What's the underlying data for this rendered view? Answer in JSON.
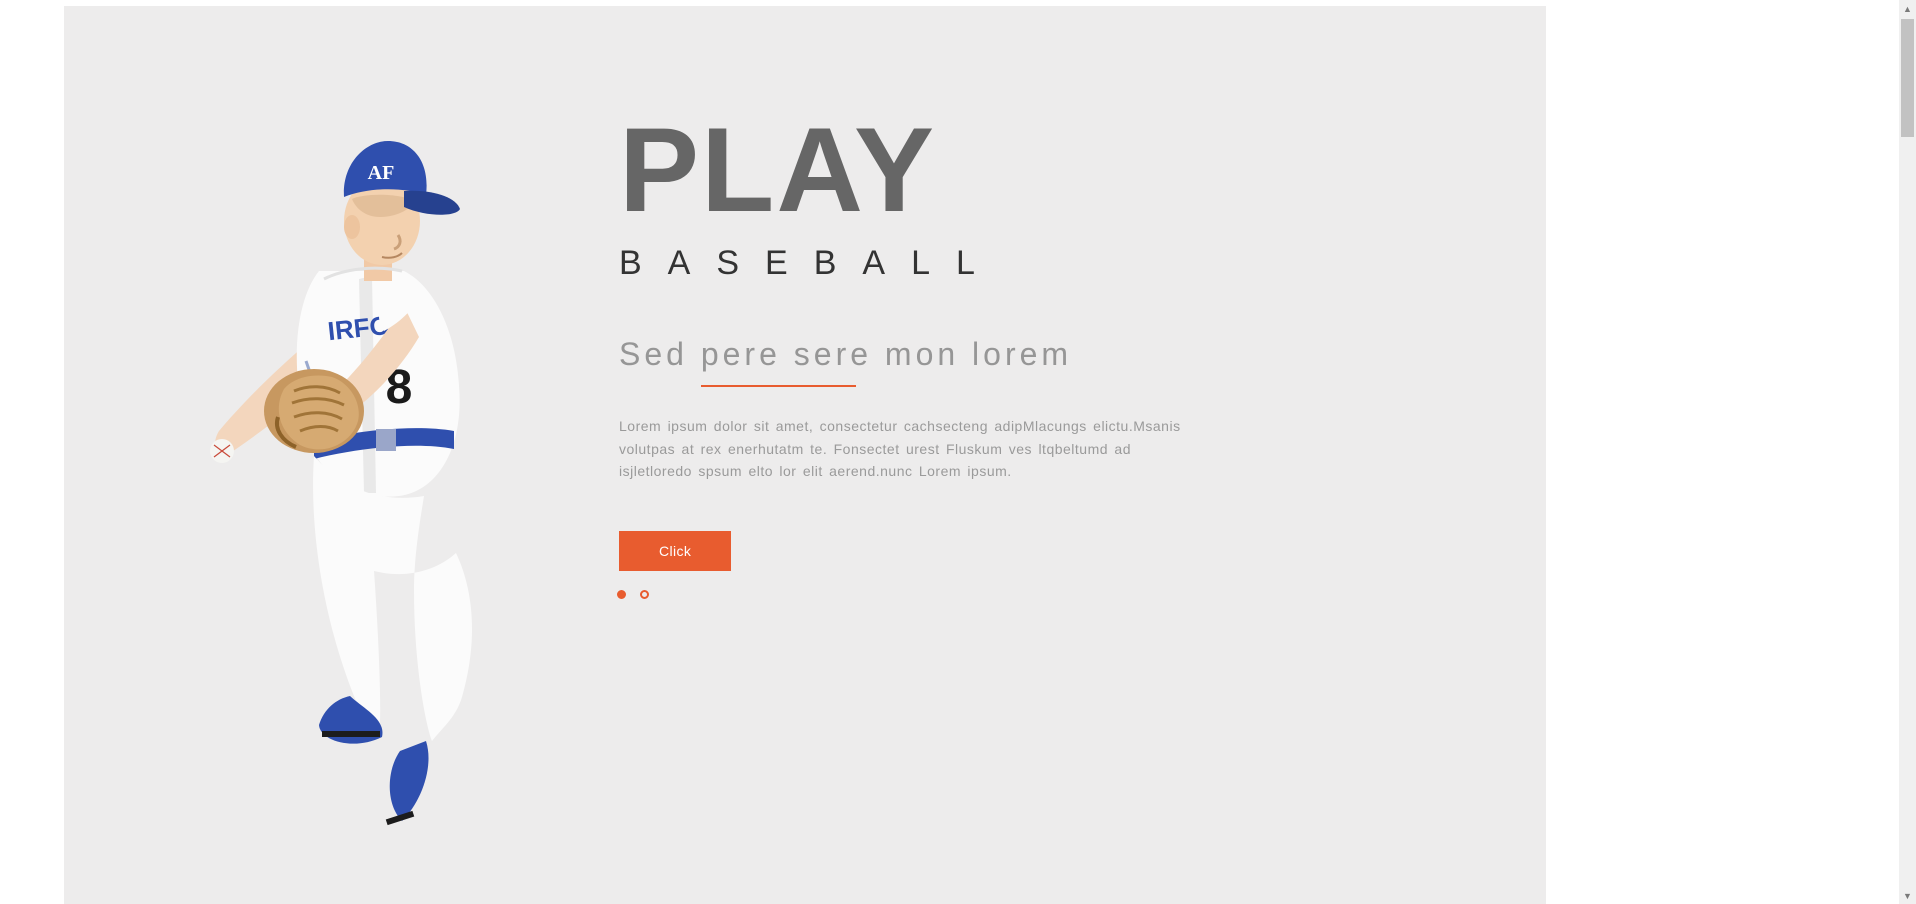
{
  "hero": {
    "title": "PLAY",
    "subtitle": "BASEBALL",
    "tagline": "Sed pere sere mon lorem",
    "body": "Lorem ipsum dolor sit amet, consectetur cachsecteng adipMlacungs elictu.Msanis volutpas at rex enerhutatm te. Fonsectet urest Fluskum ves ltqbeltumd ad isjletloredo spsum elto lor elit aerend.nunc Lorem ipsum.",
    "cta_label": "Click"
  },
  "slider": {
    "active_index": 0,
    "total": 2
  },
  "colors": {
    "accent": "#e85c2f",
    "bg": "#edecec",
    "title": "#666666",
    "text": "#9a9a9a"
  },
  "image": {
    "alt": "baseball-player-pitching"
  }
}
